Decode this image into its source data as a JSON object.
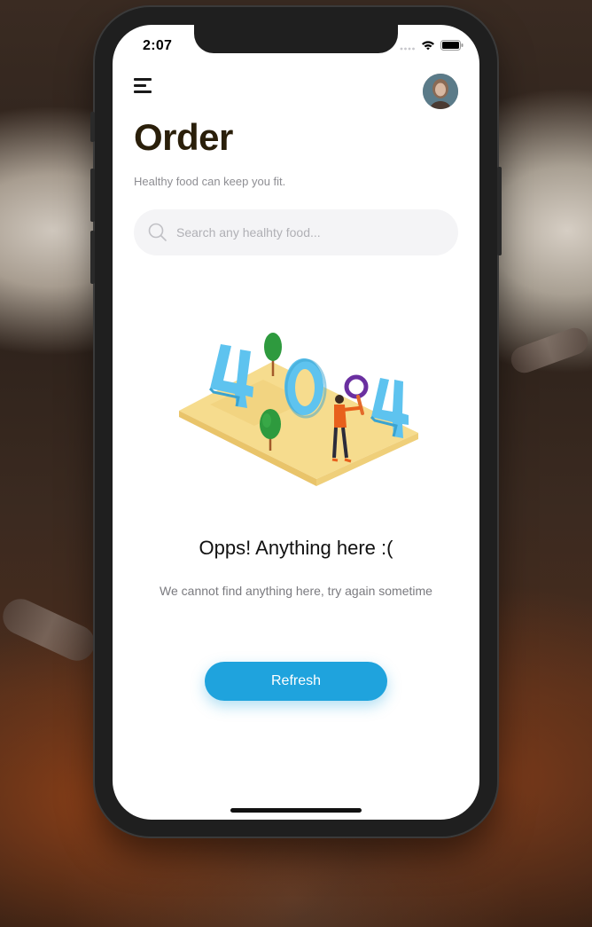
{
  "status_bar": {
    "time": "2:07"
  },
  "header": {
    "title": "Order",
    "subtitle": "Healthy food can keep you fit."
  },
  "search": {
    "placeholder": "Search any healhty food...",
    "value": ""
  },
  "illustration": {
    "label": "404"
  },
  "empty_state": {
    "title": "Opps! Anything here :(",
    "message": "We cannot find anything here, try again sometime",
    "button_label": "Refresh"
  },
  "colors": {
    "accent": "#1fa3dd",
    "title": "#2a1f0a",
    "search_bg": "#f4f4f6"
  },
  "icons": {
    "menu": "hamburger-icon",
    "search": "search-icon",
    "wifi": "wifi-icon",
    "battery": "battery-icon",
    "signal": "signal-icon"
  }
}
